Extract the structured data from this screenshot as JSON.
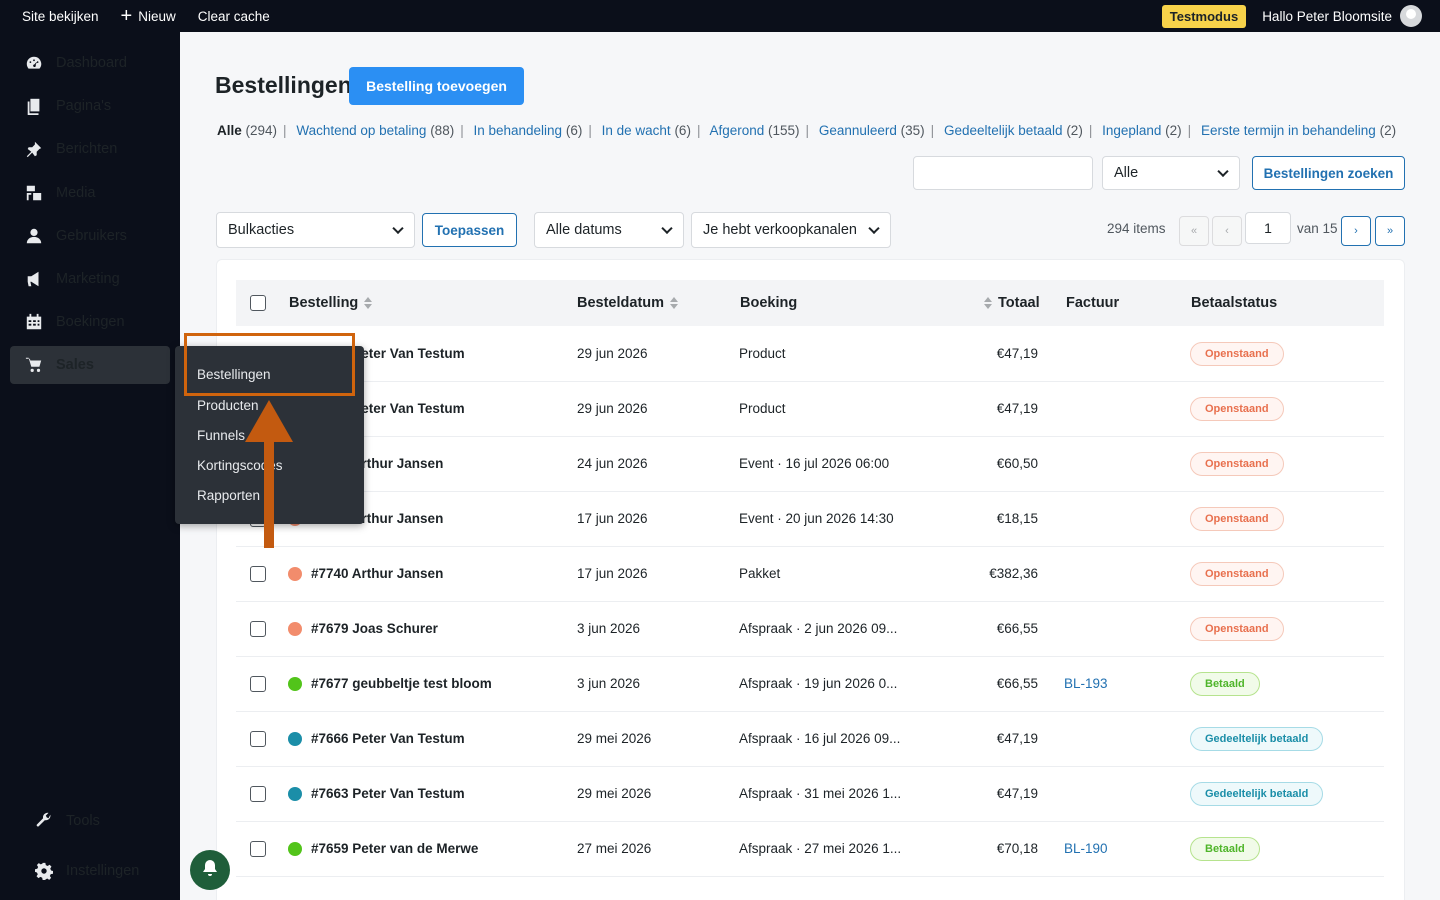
{
  "topbar": {
    "site_link": "Site bekijken",
    "new_label": "Nieuw",
    "clear_cache": "Clear cache",
    "test_mode": "Testmodus",
    "greeting": "Hallo Peter Bloomsite"
  },
  "sidebar": {
    "items": [
      {
        "label": "Dashboard",
        "icon": "dashboard-icon"
      },
      {
        "label": "Pagina's",
        "icon": "pages-icon"
      },
      {
        "label": "Berichten",
        "icon": "pin-icon"
      },
      {
        "label": "Media",
        "icon": "media-icon"
      },
      {
        "label": "Gebruikers",
        "icon": "user-icon"
      },
      {
        "label": "Marketing",
        "icon": "megaphone-icon"
      },
      {
        "label": "Boekingen",
        "icon": "calendar-icon"
      },
      {
        "label": "Sales",
        "icon": "cart-icon"
      }
    ],
    "tools": "Tools",
    "settings": "Instellingen",
    "submenu": [
      "Bestellingen",
      "Producten",
      "Funnels",
      "Kortingscodes",
      "Rapporten"
    ]
  },
  "page": {
    "title": "Bestellingen",
    "add_button": "Bestelling toevoegen"
  },
  "filters": [
    {
      "label": "Alle",
      "count": "(294)",
      "current": true
    },
    {
      "label": "Wachtend op betaling",
      "count": "(88)"
    },
    {
      "label": "In behandeling",
      "count": "(6)"
    },
    {
      "label": "In de wacht",
      "count": "(6)"
    },
    {
      "label": "Afgerond",
      "count": "(155)"
    },
    {
      "label": "Geannuleerd",
      "count": "(35)"
    },
    {
      "label": "Gedeeltelijk betaald",
      "count": "(2)"
    },
    {
      "label": "Ingepland",
      "count": "(2)"
    },
    {
      "label": "Eerste termijn in behandeling",
      "count": "(2)"
    }
  ],
  "search": {
    "value": "",
    "status_select": "Alle",
    "button": "Bestellingen zoeken"
  },
  "toolbar": {
    "bulk_actions": "Bulkacties",
    "apply": "Toepassen",
    "dates": "Alle datums",
    "channels": "Je hebt verkoopkanalen",
    "items_count": "294 items",
    "first": "«",
    "prev": "‹",
    "current_page": "1",
    "of_pages": "van 15",
    "next": "›",
    "last": "»"
  },
  "table": {
    "columns": [
      "Bestelling",
      "Besteldatum",
      "Boeking",
      "Totaal",
      "Factuur",
      "Betaalstatus"
    ],
    "rows": [
      {
        "order": "#7755 Peter Van Testum",
        "date": "29 jun 2026",
        "booking": "Product",
        "total": "€47,19",
        "invoice": "",
        "status": "Openstaand",
        "type": "open",
        "dot": "#f28c6c"
      },
      {
        "order": "#7754 Peter Van Testum",
        "date": "29 jun 2026",
        "booking": "Product",
        "total": "€47,19",
        "invoice": "",
        "status": "Openstaand",
        "type": "open",
        "dot": "#f28c6c"
      },
      {
        "order": "#7745 Arthur Jansen",
        "date": "24 jun 2026",
        "booking": "Event · 16 jul 2026 06:00",
        "total": "€60,50",
        "invoice": "",
        "status": "Openstaand",
        "type": "open",
        "dot": "#f28c6c"
      },
      {
        "order": "#7741 Arthur Jansen",
        "date": "17 jun 2026",
        "booking": "Event · 20 jun 2026 14:30",
        "total": "€18,15",
        "invoice": "",
        "status": "Openstaand",
        "type": "open",
        "dot": "#f28c6c"
      },
      {
        "order": "#7740 Arthur Jansen",
        "date": "17 jun 2026",
        "booking": "Pakket",
        "total": "€382,36",
        "invoice": "",
        "status": "Openstaand",
        "type": "open",
        "dot": "#f28c6c"
      },
      {
        "order": "#7679 Joas Schurer",
        "date": "3 jun 2026",
        "booking": "Afspraak · 2 jun 2026 09...",
        "total": "€66,55",
        "invoice": "",
        "status": "Openstaand",
        "type": "open",
        "dot": "#f28c6c"
      },
      {
        "order": "#7677 geubbeltje test bloom",
        "date": "3 jun 2026",
        "booking": "Afspraak · 19 jun 2026 0...",
        "total": "€66,55",
        "invoice": "BL-193",
        "status": "Betaald",
        "type": "paid",
        "dot": "#52c41a"
      },
      {
        "order": "#7666 Peter Van Testum",
        "date": "29 mei 2026",
        "booking": "Afspraak · 16 jul 2026 09...",
        "total": "€47,19",
        "invoice": "",
        "status": "Gedeeltelijk betaald",
        "type": "part",
        "dot": "#1b8ea8"
      },
      {
        "order": "#7663 Peter Van Testum",
        "date": "29 mei 2026",
        "booking": "Afspraak · 31 mei 2026 1...",
        "total": "€47,19",
        "invoice": "",
        "status": "Gedeeltelijk betaald",
        "type": "part",
        "dot": "#1b8ea8"
      },
      {
        "order": "#7659 Peter van de Merwe",
        "date": "27 mei 2026",
        "booking": "Afspraak · 27 mei 2026 1...",
        "total": "€70,18",
        "invoice": "BL-190",
        "status": "Betaald",
        "type": "paid",
        "dot": "#52c41a"
      }
    ]
  },
  "colors": {
    "accent": "#2b8ff3",
    "sidebar_bg": "#0b0f1a",
    "highlight": "#d0640d"
  }
}
